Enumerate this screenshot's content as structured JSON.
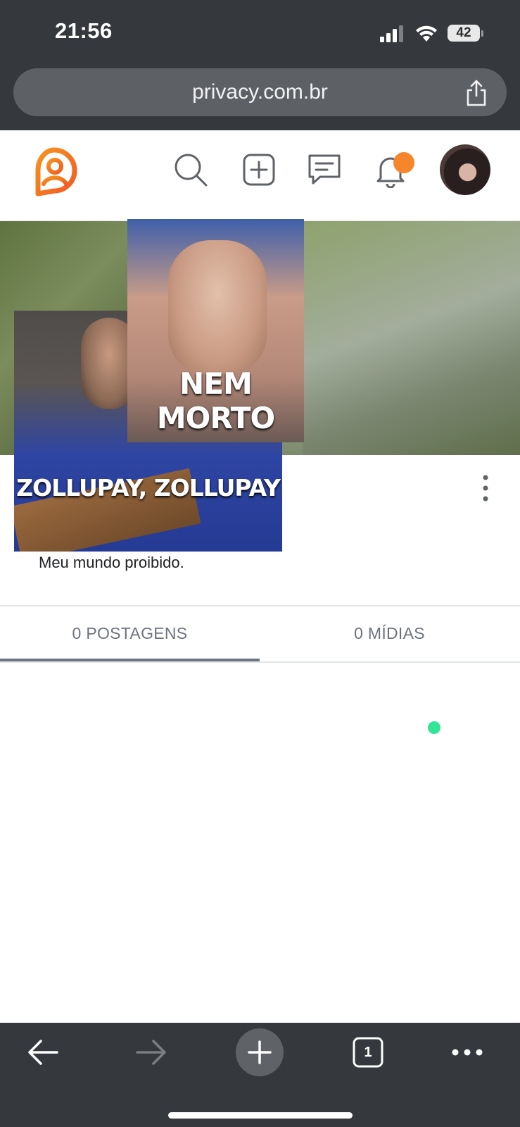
{
  "status_bar": {
    "time": "21:56",
    "battery": "42"
  },
  "browser": {
    "url": "privacy.com.br",
    "tab_count": "1"
  },
  "header": {
    "icons": [
      "logo-icon",
      "search-icon",
      "add-post-icon",
      "messages-icon",
      "bell-icon",
      "avatar"
    ],
    "notification_color": "#f5862b",
    "brand_color": "#f15a24"
  },
  "cover": {
    "meme_top_caption": "NEM MORTO",
    "meme_bottom_caption": "ZOLLUPAY, ZOLLUPAY"
  },
  "profile": {
    "bio": "Meu mundo proibido."
  },
  "tabs": [
    {
      "label": "0 POSTAGENS",
      "active": true
    },
    {
      "label": "0 MÍDIAS",
      "active": false
    }
  ],
  "status_indicator_color": "#33e597"
}
